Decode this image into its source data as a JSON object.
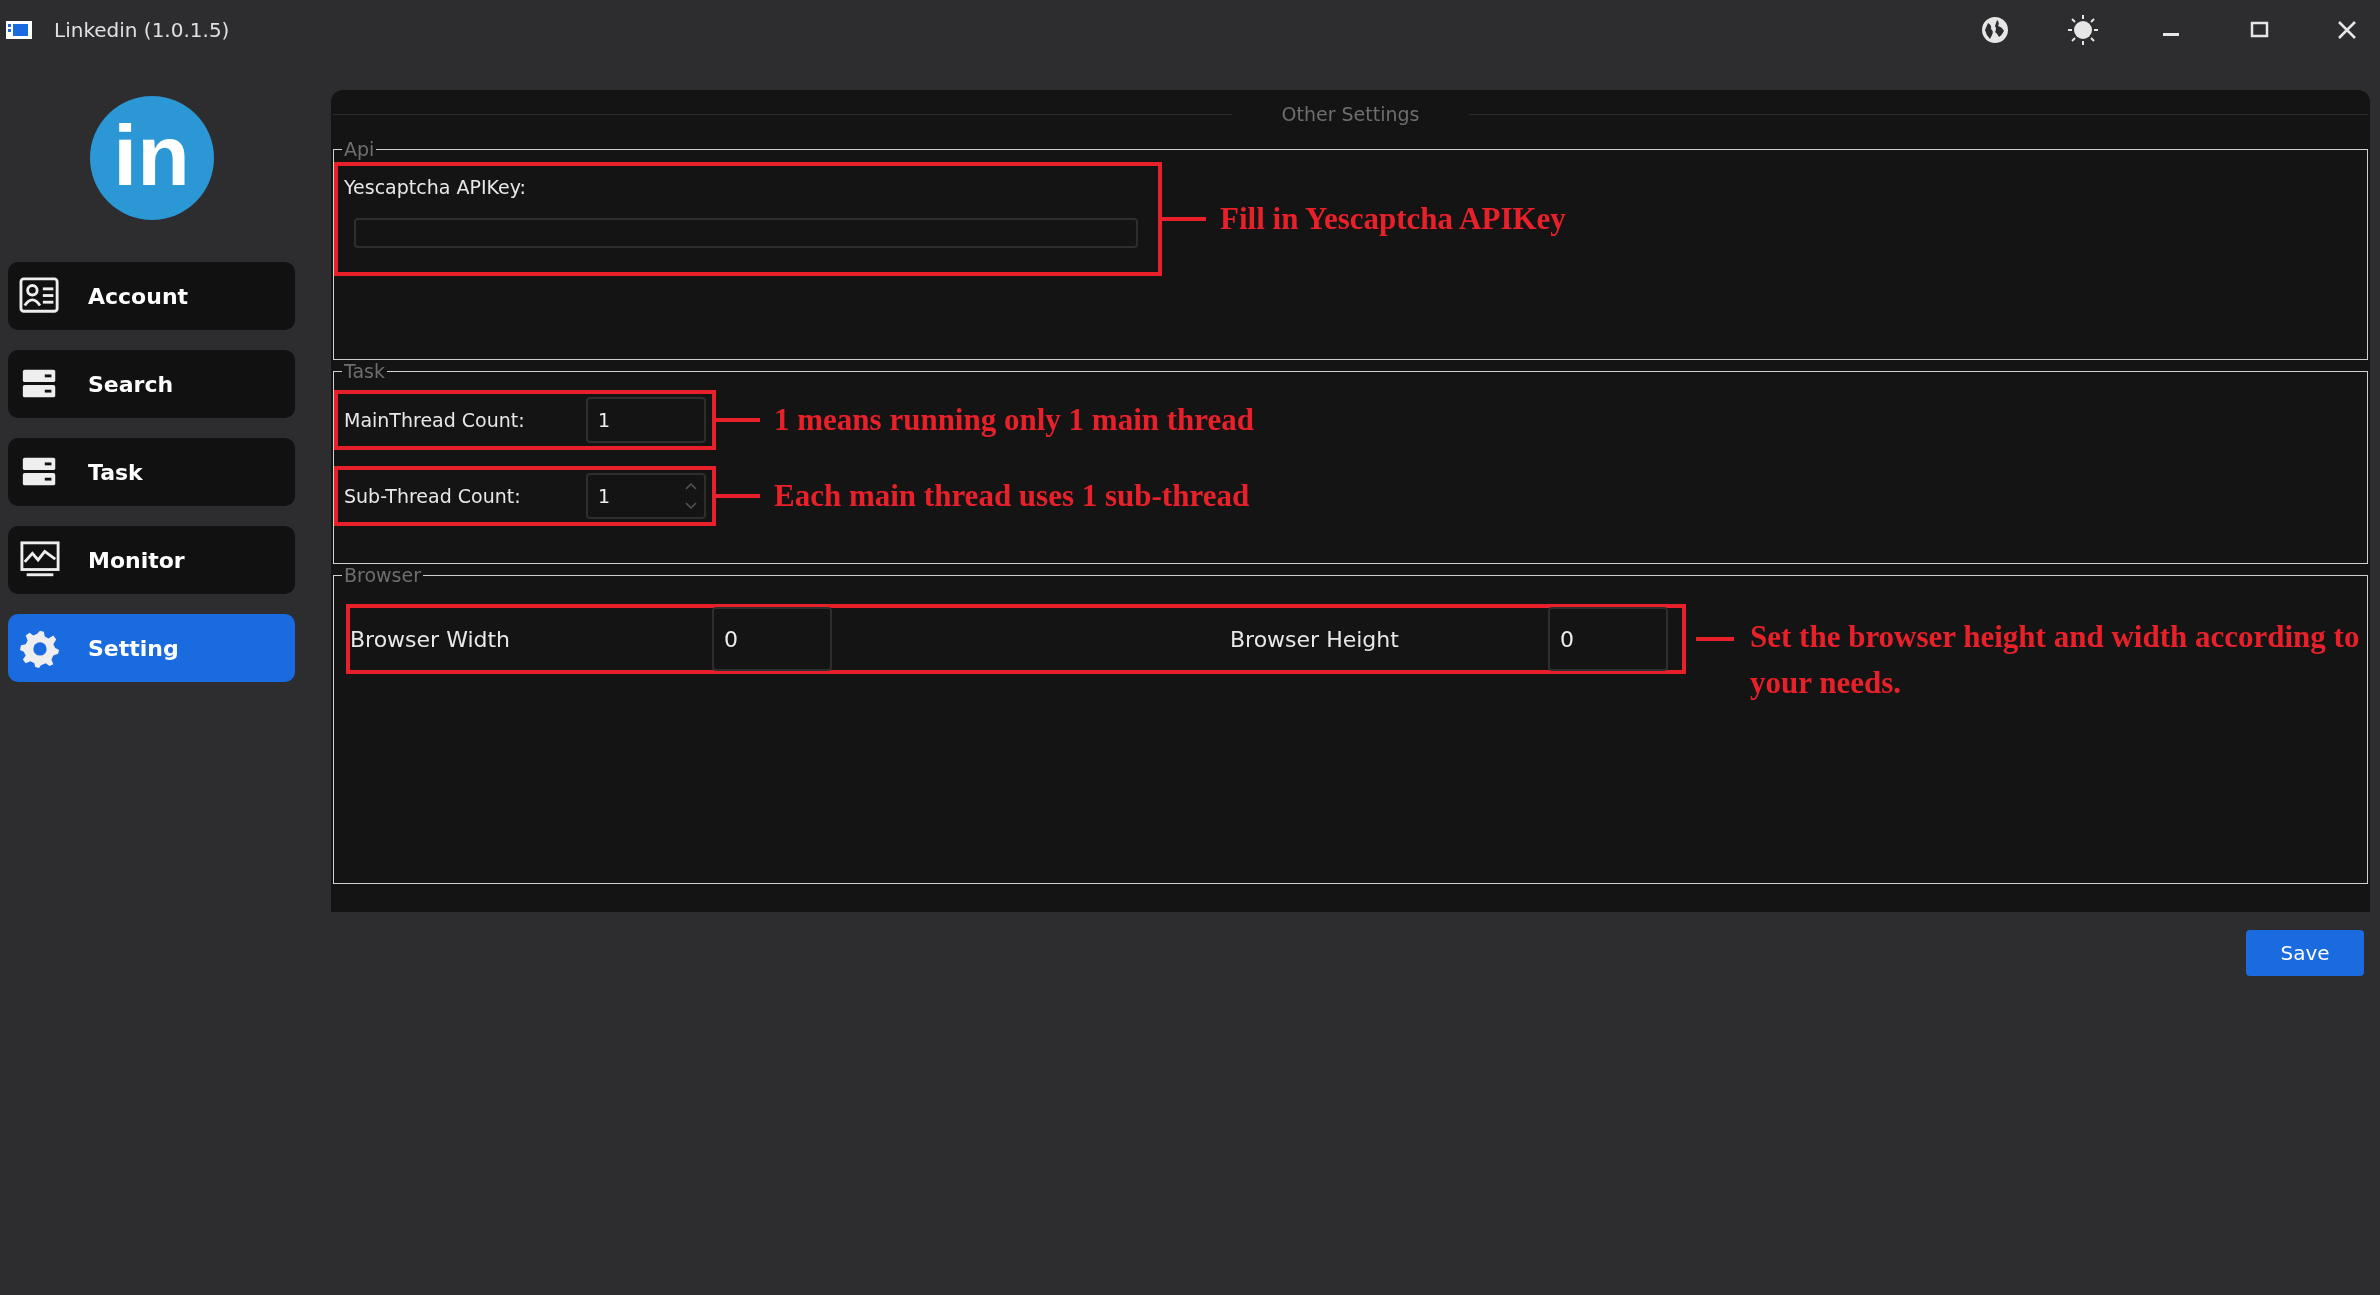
{
  "window": {
    "title": "Linkedin (1.0.1.5)"
  },
  "sidebar": {
    "logo_text": "in",
    "items": [
      {
        "label": "Account",
        "selected": false
      },
      {
        "label": "Search",
        "selected": false
      },
      {
        "label": "Task",
        "selected": false
      },
      {
        "label": "Monitor",
        "selected": false
      },
      {
        "label": "Setting",
        "selected": true
      }
    ]
  },
  "panel": {
    "title": "Other Settings",
    "groups": [
      {
        "title": "Api",
        "rows": [
          {
            "fields": [
              {
                "label": "Yescaptcha APIKey:",
                "kind": "text"
              }
            ],
            "note": "Fill in Yescaptcha APIKey"
          }
        ]
      },
      {
        "title": "Task",
        "rows": [
          {
            "fields": [
              {
                "label": "MainThread Count:",
                "kind": "number",
                "value": "1"
              }
            ],
            "note": "1 means running only 1 main thread"
          },
          {
            "fields": [
              {
                "label": "Sub-Thread Count:",
                "kind": "spinbox",
                "value": "1"
              }
            ],
            "note": "Each main thread uses 1 sub-thread"
          }
        ]
      },
      {
        "title": "Browser",
        "rows": [
          {
            "fields": [
              {
                "label": "Browser Width",
                "kind": "number",
                "value": "0"
              },
              {
                "label": "Browser Height",
                "kind": "number",
                "value": "0"
              }
            ],
            "note": "Set the browser height and width according to your needs."
          }
        ]
      }
    ]
  },
  "save_button": "Save"
}
